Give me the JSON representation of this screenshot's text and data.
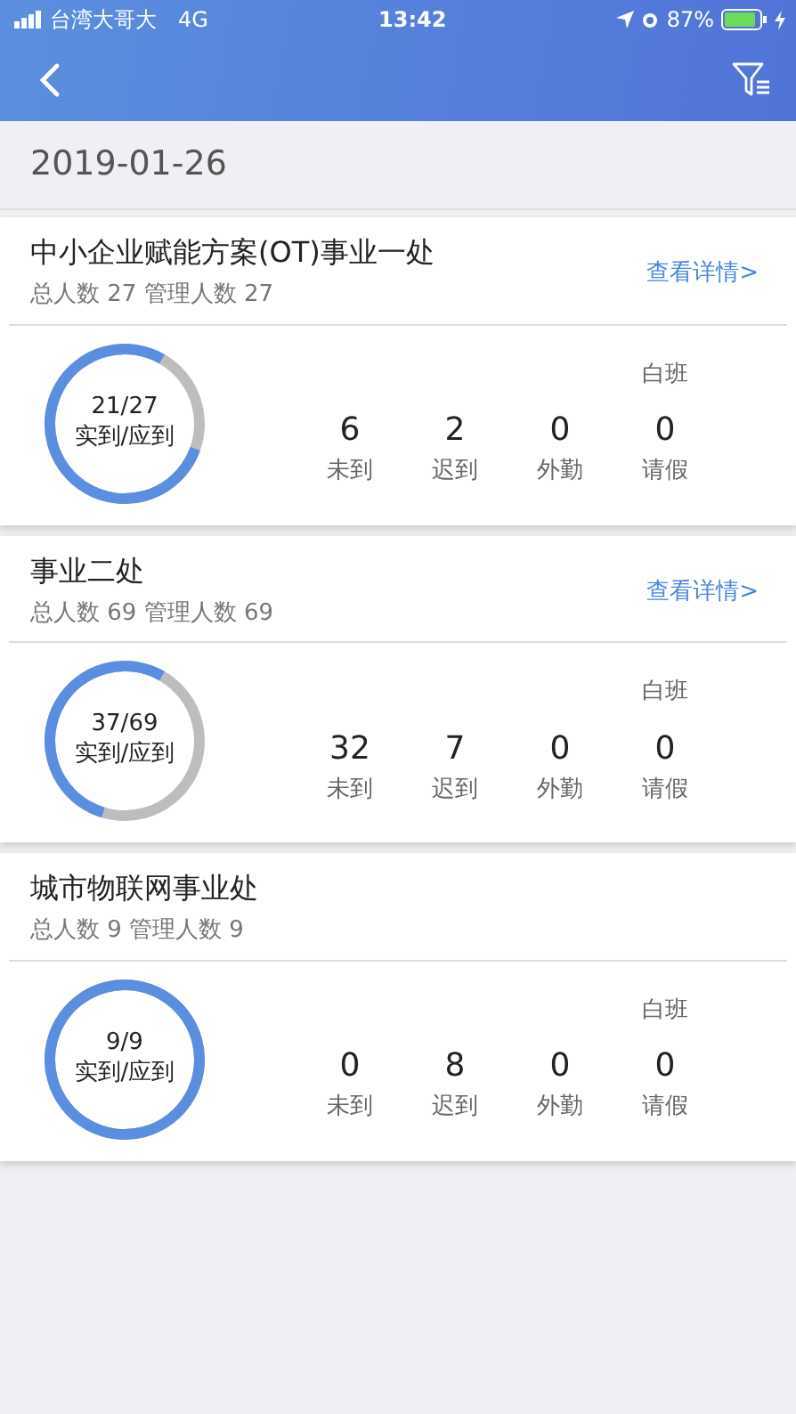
{
  "status_bar": {
    "carrier": "台湾大哥大",
    "network": "4G",
    "time": "13:42",
    "battery": "87%"
  },
  "date": "2019-01-26",
  "departments": [
    {
      "name": "中小企业赋能方案(OT)事业一处",
      "summary": "总人数 27 管理人数 27",
      "details_link": "查看详情>",
      "ratio": "21/27",
      "ratio_label": "实到/应到",
      "shift": "白班",
      "stats": [
        {
          "value": "6",
          "label": "未到"
        },
        {
          "value": "2",
          "label": "迟到"
        },
        {
          "value": "0",
          "label": "外勤"
        },
        {
          "value": "0",
          "label": "请假"
        }
      ]
    },
    {
      "name": "事业二处",
      "summary": "总人数 69 管理人数 69",
      "details_link": "查看详情>",
      "ratio": "37/69",
      "ratio_label": "实到/应到",
      "shift": "白班",
      "stats": [
        {
          "value": "32",
          "label": "未到"
        },
        {
          "value": "7",
          "label": "迟到"
        },
        {
          "value": "0",
          "label": "外勤"
        },
        {
          "value": "0",
          "label": "请假"
        }
      ]
    },
    {
      "name": "城市物联网事业处",
      "summary": "总人数 9 管理人数 9",
      "ratio": "9/9",
      "ratio_label": "实到/应到",
      "shift": "白班",
      "stats": [
        {
          "value": "0",
          "label": "未到"
        },
        {
          "value": "8",
          "label": "迟到"
        },
        {
          "value": "0",
          "label": "外勤"
        },
        {
          "value": "0",
          "label": "请假"
        }
      ]
    }
  ]
}
